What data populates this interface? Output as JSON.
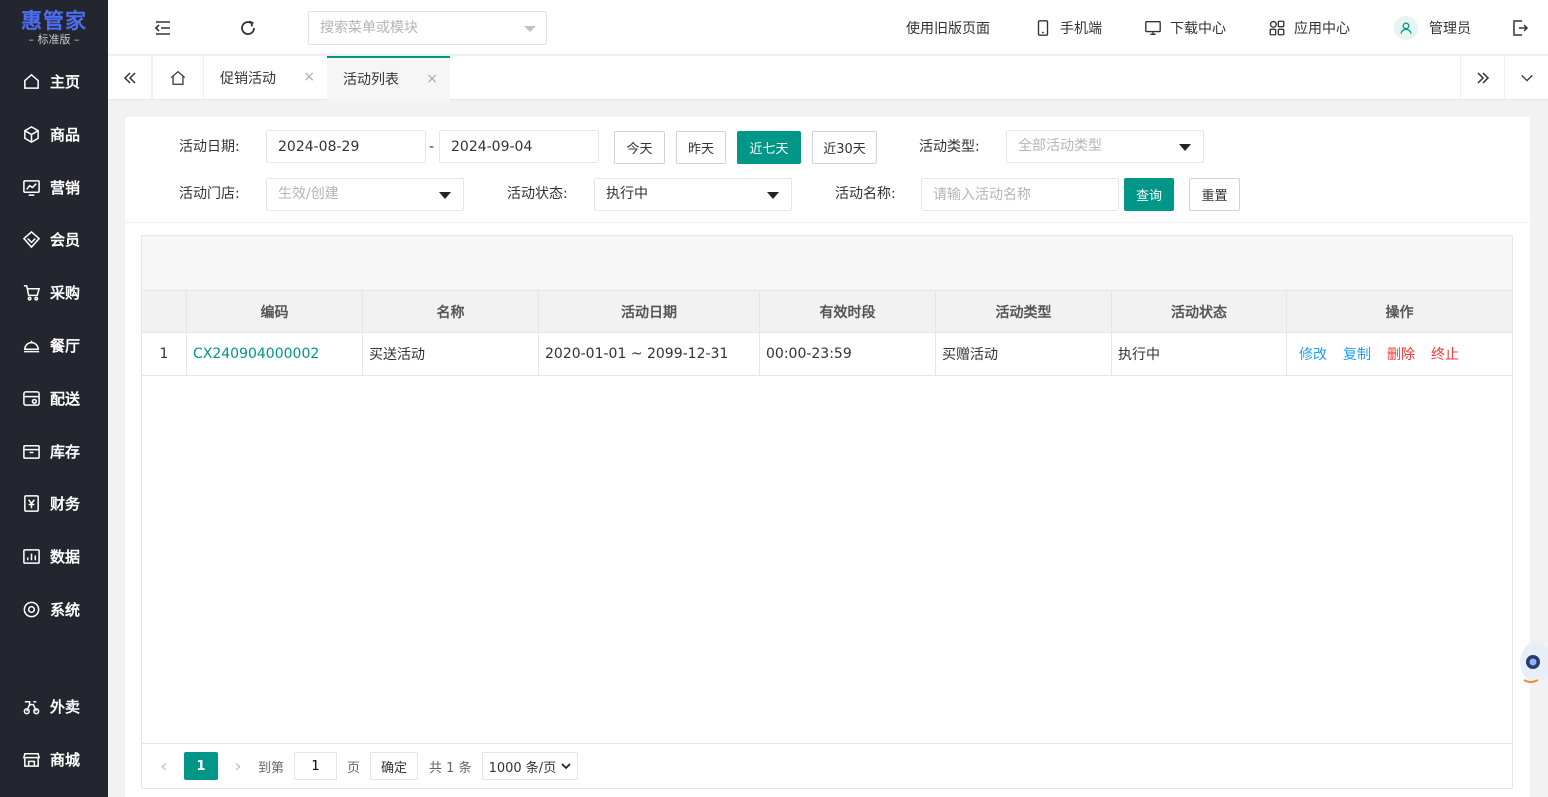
{
  "brand": {
    "name": "惠管家",
    "edition": "– 标准版 –",
    "color": "#4e6ef2"
  },
  "sidebar": {
    "items": [
      {
        "label": "主页",
        "icon": "home-icon"
      },
      {
        "label": "商品",
        "icon": "box-icon"
      },
      {
        "label": "营销",
        "icon": "chart-icon"
      },
      {
        "label": "会员",
        "icon": "diamond-icon"
      },
      {
        "label": "采购",
        "icon": "cart-icon"
      },
      {
        "label": "餐厅",
        "icon": "cloche-icon"
      },
      {
        "label": "配送",
        "icon": "delivery-icon"
      },
      {
        "label": "库存",
        "icon": "storage-icon"
      },
      {
        "label": "财务",
        "icon": "yen-icon"
      },
      {
        "label": "数据",
        "icon": "bar-chart-icon"
      },
      {
        "label": "系统",
        "icon": "settings-icon"
      },
      {
        "label": "外卖",
        "icon": "scooter-icon"
      },
      {
        "label": "商城",
        "icon": "shop-icon"
      }
    ]
  },
  "header": {
    "search_placeholder": "搜索菜单或模块",
    "old_page": "使用旧版页面",
    "mobile": "手机端",
    "downloads": "下载中心",
    "apps": "应用中心",
    "user": "管理员"
  },
  "tabs": [
    {
      "label": "促销活动",
      "close": "×"
    },
    {
      "label": "活动列表",
      "close": "×"
    }
  ],
  "filters": {
    "date_label": "活动日期:",
    "date_from": "2024-08-29",
    "date_sep": "-",
    "date_to": "2024-09-04",
    "btn_today": "今天",
    "btn_yesterday": "昨天",
    "btn_7days": "近七天",
    "btn_30days": "近30天",
    "type_label": "活动类型:",
    "type_placeholder": "全部活动类型",
    "store_label": "活动门店:",
    "store_placeholder": "生效/创建",
    "status_label": "活动状态:",
    "status_value": "执行中",
    "name_label": "活动名称:",
    "name_placeholder": "请输入活动名称",
    "btn_query": "查询",
    "btn_reset": "重置"
  },
  "table": {
    "headers": [
      "",
      "编码",
      "名称",
      "活动日期",
      "有效时段",
      "活动类型",
      "活动状态",
      "操作"
    ],
    "rows": [
      {
        "index": "1",
        "code": "CX240904000002",
        "name": "买送活动",
        "date": "2020-01-01 ~ 2099-12-31",
        "period": "00:00-23:59",
        "type": "买赠活动",
        "status": "执行中",
        "ops": [
          "修改",
          "复制",
          "删除",
          "终止"
        ]
      }
    ]
  },
  "pager": {
    "prev": "‹",
    "current": "1",
    "next": "›",
    "goto_label": "到第",
    "goto_value": "1",
    "page_unit": "页",
    "confirm": "确定",
    "total": "共 1 条",
    "page_size": "1000 条/页"
  },
  "colors": {
    "accent": "#009688",
    "sidebar": "#23262e",
    "link_blue": "#1e9fff",
    "danger": "#ff3333"
  }
}
